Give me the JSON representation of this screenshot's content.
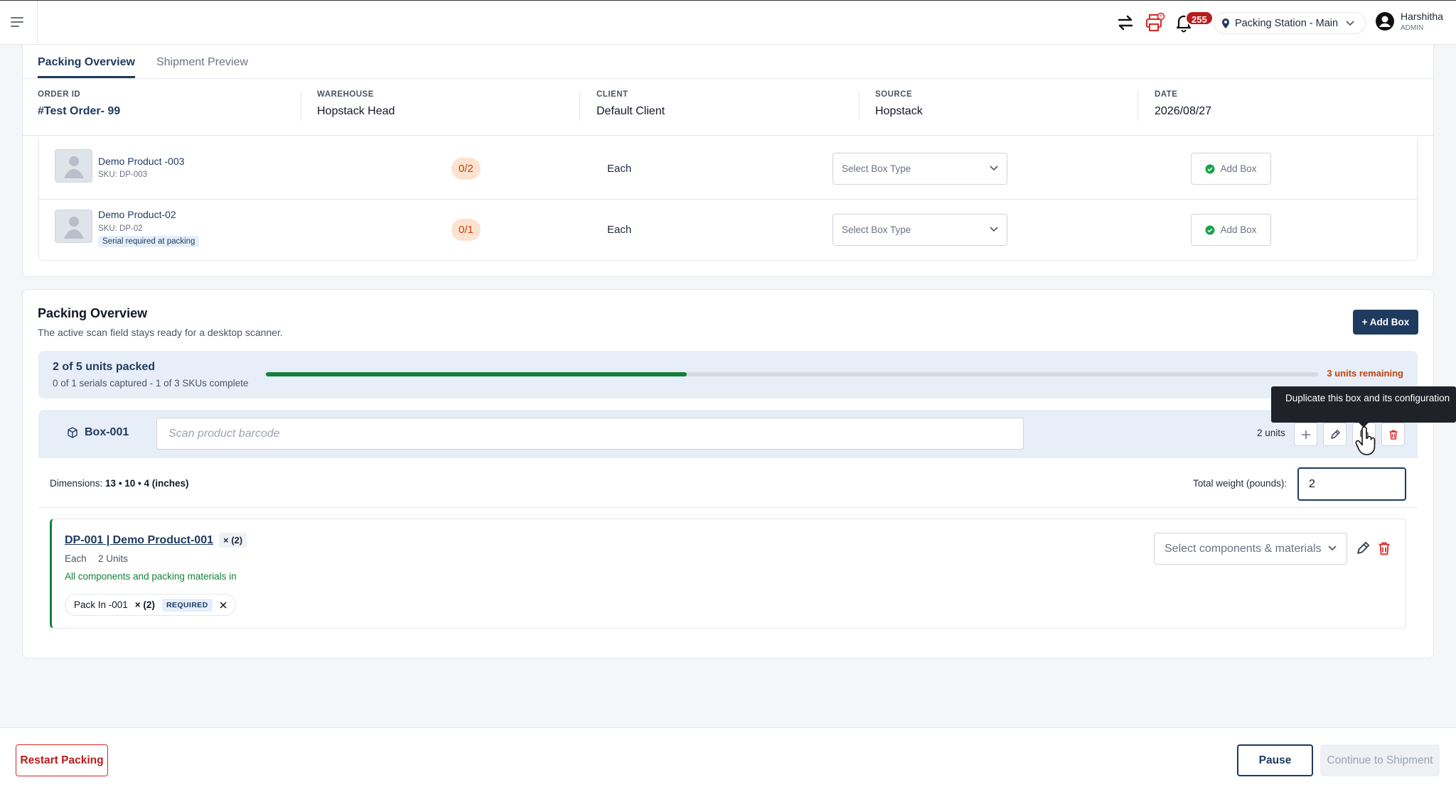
{
  "topbar": {
    "icons": [
      "menu-icon",
      "switch-icon",
      "printer-alert-icon",
      "bell-icon"
    ],
    "notification_count": "255",
    "station": "Packing Station - Main",
    "user_name": "Harshitha",
    "user_role": "ADMIN"
  },
  "tabs": [
    {
      "label": "Packing Overview",
      "active": true
    },
    {
      "label": "Shipment Preview",
      "active": false
    }
  ],
  "order": {
    "order_id_label": "ORDER ID",
    "order_id": "#Test Order- 99",
    "warehouse_label": "WAREHOUSE",
    "warehouse": "Hopstack Head",
    "client_label": "CLIENT",
    "client": "Default Client",
    "source_label": "SOURCE",
    "source": "Hopstack",
    "date_label": "DATE",
    "date": "2026/08/27"
  },
  "products": [
    {
      "name": "Demo Product -003",
      "sku": "SKU: DP-003",
      "tag": "",
      "qty": "0/2",
      "uom": "Each",
      "box_type_placeholder": "Select Box Type",
      "add_box": "Add Box"
    },
    {
      "name": "Demo Product-02",
      "sku": "SKU: DP-02",
      "tag": "Serial required at packing",
      "qty": "0/1",
      "uom": "Each",
      "box_type_placeholder": "Select Box Type",
      "add_box": "Add Box"
    }
  ],
  "packing": {
    "title": "Packing Overview",
    "subtitle": "The active scan field stays ready for a desktop scanner.",
    "add_box_label": "+ Add Box",
    "progress_title": "2 of 5 units packed",
    "progress_sub": "0 of 1 serials captured - 1 of 3 SKUs complete",
    "progress_fraction": 0.4,
    "remaining": "3 units remaining",
    "box": {
      "name": "Box-001",
      "scan_placeholder": "Scan product barcode",
      "units": "2 units",
      "tooltip": "Duplicate this box and its configuration",
      "dims_label": "Dimensions:",
      "dims_value": "13 • 10 • 4 (inches)",
      "weight_label": "Total weight (pounds):",
      "weight_value": "2"
    },
    "item": {
      "title": "DP-001 | Demo Product-001",
      "qty": "× (2)",
      "uom": "Each",
      "units": "2 Units",
      "status": "All components and packing materials in",
      "chip_name": "Pack In -001",
      "chip_qty": "× (2)",
      "chip_badge": "REQUIRED",
      "components_placeholder": "Select components & materials"
    }
  },
  "footer": {
    "restart": "Restart Packing",
    "pause": "Pause",
    "continue": "Continue to Shipment"
  },
  "colors": {
    "brand": "#1e3a5f",
    "success": "#15803d",
    "danger": "#b91c1c",
    "warning": "#c2410c"
  }
}
